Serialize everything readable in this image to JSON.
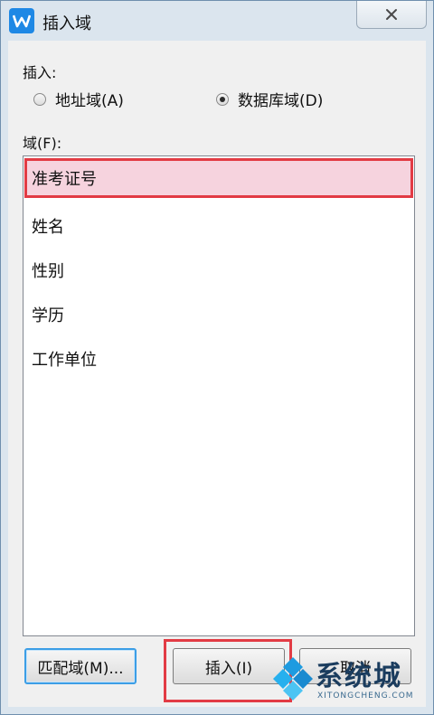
{
  "window": {
    "title": "插入域"
  },
  "insert_group": {
    "label": "插入:",
    "options": [
      {
        "label": "地址域(A)",
        "selected": false
      },
      {
        "label": "数据库域(D)",
        "selected": true
      }
    ]
  },
  "fields": {
    "label": "域(F):",
    "items": [
      {
        "label": "准考证号",
        "selected": true
      },
      {
        "label": "姓名",
        "selected": false
      },
      {
        "label": "性别",
        "selected": false
      },
      {
        "label": "学历",
        "selected": false
      },
      {
        "label": "工作单位",
        "selected": false
      }
    ]
  },
  "buttons": {
    "match": "匹配域(M)...",
    "insert": "插入(I)",
    "cancel": "取消"
  },
  "watermark": {
    "text": "系统城",
    "sub": "XITONGCHENG.COM"
  },
  "colors": {
    "highlight": "#e23b44",
    "selected_bg": "#f6d3de",
    "accent": "#3c9ee6"
  }
}
